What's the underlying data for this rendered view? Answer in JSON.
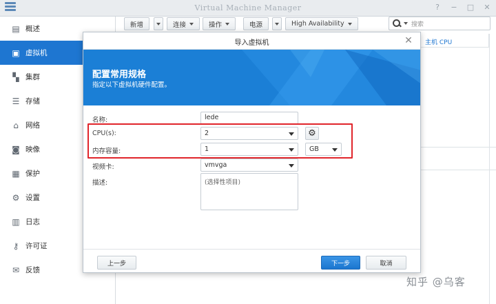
{
  "window": {
    "title": "Virtual Machine Manager"
  },
  "sidebar": {
    "items": [
      {
        "label": "概述",
        "icon": "overview-icon"
      },
      {
        "label": "虚拟机",
        "icon": "virtual-machine-icon",
        "active": true
      },
      {
        "label": "集群",
        "icon": "cluster-icon"
      },
      {
        "label": "存储",
        "icon": "storage-icon"
      },
      {
        "label": "网络",
        "icon": "network-icon"
      },
      {
        "label": "映像",
        "icon": "image-icon"
      },
      {
        "label": "保护",
        "icon": "protection-icon"
      },
      {
        "label": "设置",
        "icon": "settings-icon"
      },
      {
        "label": "日志",
        "icon": "log-icon"
      },
      {
        "label": "许可证",
        "icon": "license-icon"
      },
      {
        "label": "反馈",
        "icon": "feedback-icon"
      }
    ]
  },
  "toolbar": {
    "new_label": "新增",
    "connect_label": "连接",
    "action_label": "操作",
    "power_label": "电源",
    "ha_label": "High Availability",
    "search_placeholder": "搜索"
  },
  "background": {
    "column_header": "主机 CPU"
  },
  "dialog": {
    "title": "导入虚拟机",
    "banner_title": "配置常用规格",
    "banner_subtitle": "指定以下虚拟机硬件配置。",
    "fields": {
      "name_label": "名称:",
      "name_value": "lede",
      "cpu_label": "CPU(s):",
      "cpu_value": "2",
      "memory_label": "内存容量:",
      "memory_value": "1",
      "memory_unit": "GB",
      "video_label": "视频卡:",
      "video_value": "vmvga",
      "desc_label": "描述:",
      "desc_placeholder": "(选择性项目)"
    },
    "buttons": {
      "prev": "上一步",
      "next": "下一步",
      "cancel": "取消"
    }
  },
  "watermark": "知乎 @乌客",
  "colors": {
    "accent": "#1e76d1",
    "highlight": "#e0242a",
    "banner": "#1b7fd6"
  }
}
